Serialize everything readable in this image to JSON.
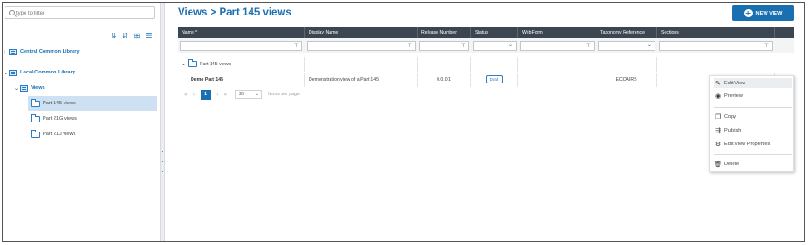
{
  "sidebar": {
    "filter_placeholder": "type to filter",
    "toolbar_icons": [
      "sort-ascending-icon",
      "sort-descending-icon",
      "hierarchy-icon",
      "list-icon"
    ],
    "tree": [
      {
        "label": "Central Common Library",
        "expanded": false
      },
      {
        "label": "Local Common Library",
        "expanded": true
      },
      {
        "label": "Views",
        "expanded": true
      },
      {
        "label": "Part 145 views",
        "selected": true
      },
      {
        "label": "Part 21G views"
      },
      {
        "label": "Part 21J views"
      }
    ]
  },
  "header": {
    "title": "Views > Part 145 views",
    "new_view_label": "NEW VIEW"
  },
  "grid": {
    "columns": [
      "Name",
      "Display Name",
      "Release Number",
      "Status",
      "WebForm",
      "Taxonomy Reference",
      "Sections"
    ],
    "name_sort_indicator": "^",
    "group_label": "Part 145 views",
    "rows": [
      {
        "name": "Demo Part 145",
        "display_name": "Demonstration view of a Part-145",
        "release_number": "0.0.0.1",
        "status": "Draft",
        "webform": "",
        "taxonomy_reference": "ECCAIRS",
        "sections": ""
      }
    ]
  },
  "pager": {
    "current_page": "1",
    "page_size": "20",
    "items_per_page_label": "Items per page"
  },
  "context_menu": {
    "items": [
      {
        "label": "Edit View",
        "icon": "pencil-icon",
        "highlighted": true
      },
      {
        "label": "Preview",
        "icon": "eye-icon"
      },
      {
        "label": "Copy",
        "icon": "copy-icon"
      },
      {
        "label": "Publish",
        "icon": "publish-icon"
      },
      {
        "label": "Edit View Properties",
        "icon": "gear-icon"
      },
      {
        "label": "Delete",
        "icon": "trash-icon"
      }
    ]
  },
  "colors": {
    "accent": "#1a6fb0",
    "header_bg": "#3c4650",
    "selection": "#cde1f3"
  }
}
